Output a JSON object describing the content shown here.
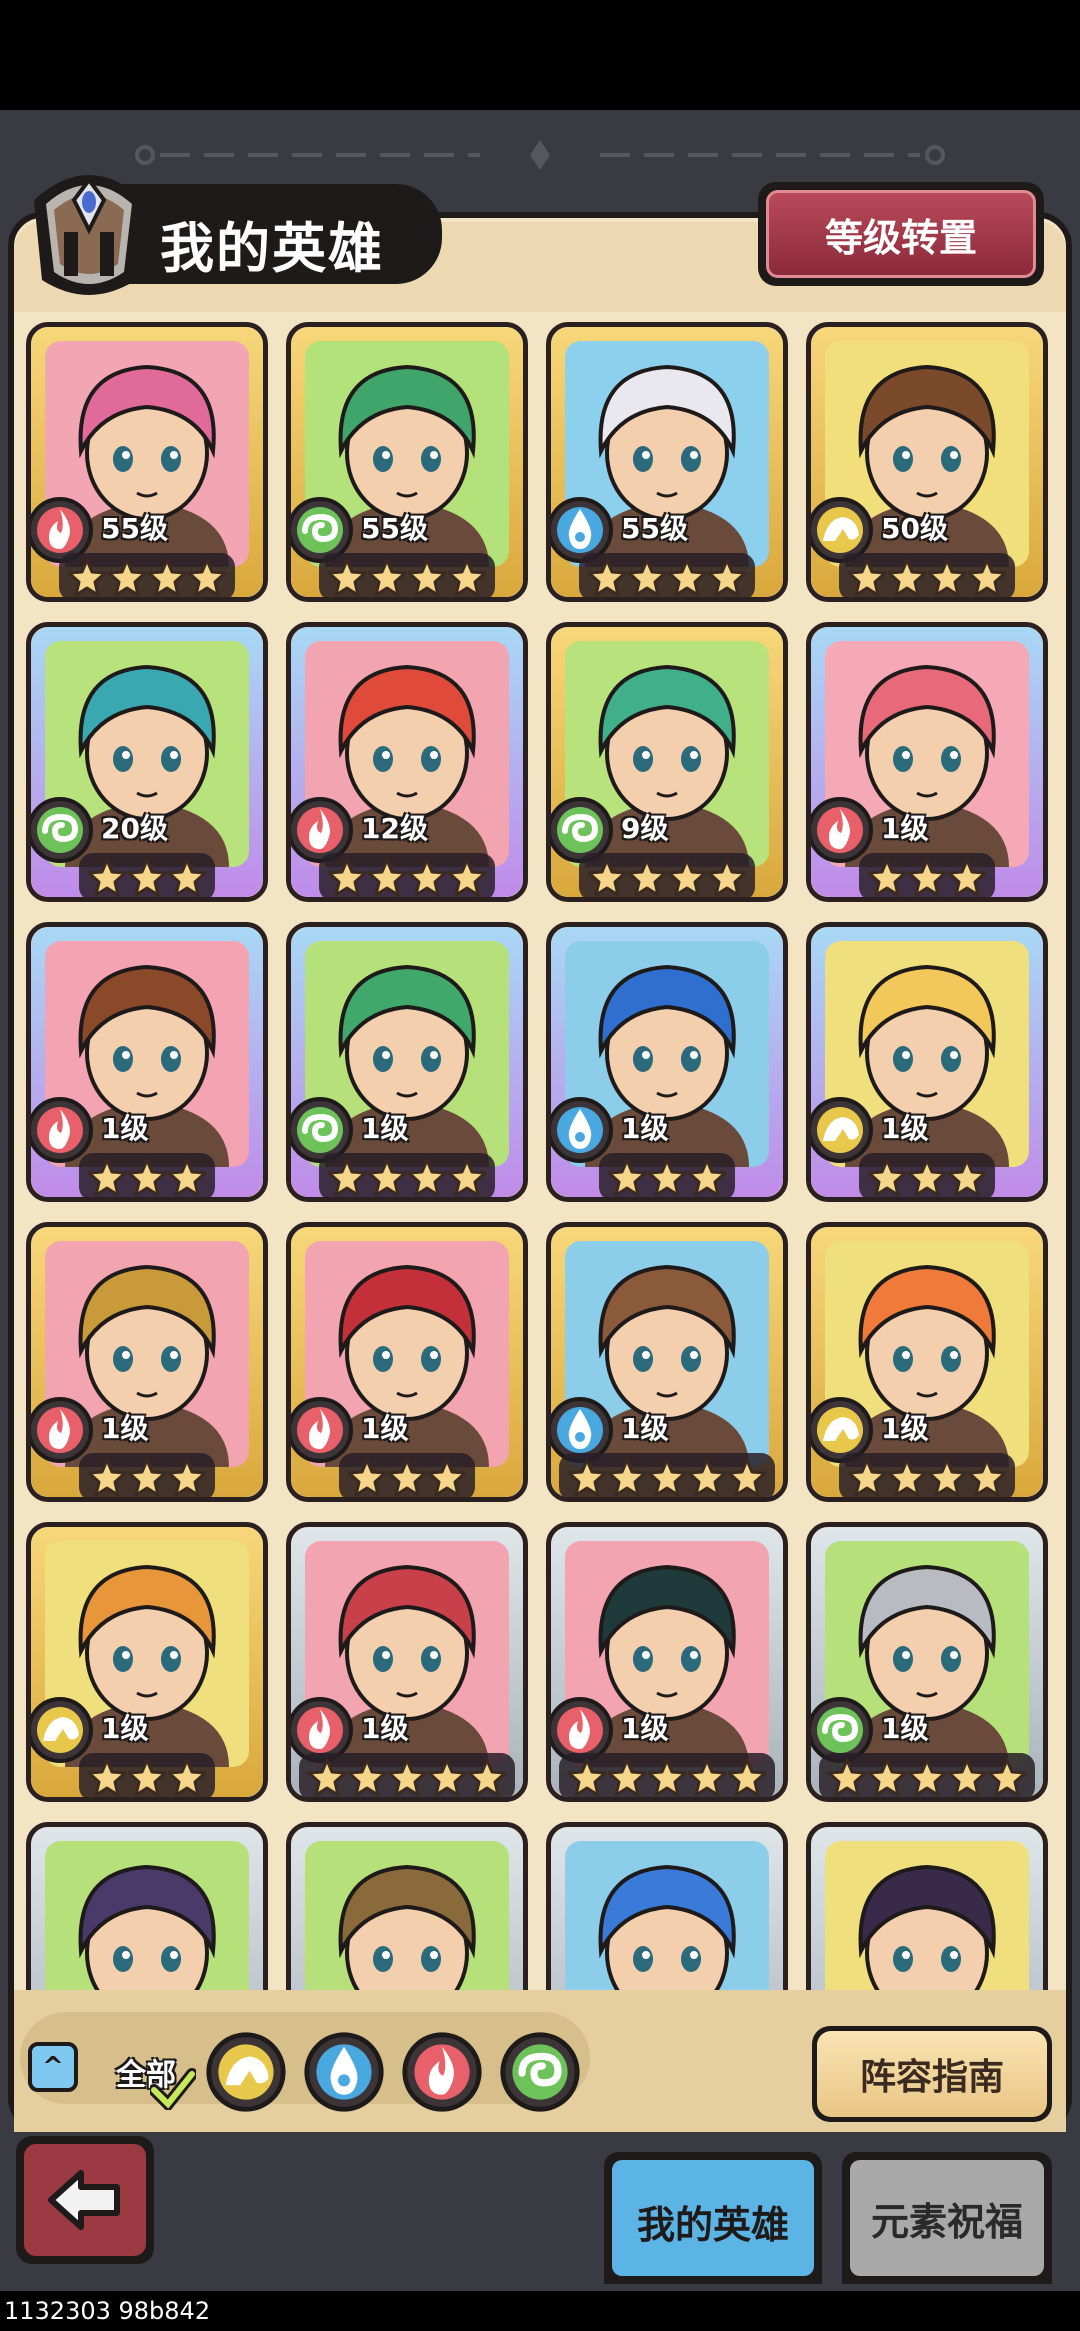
{
  "header": {
    "title": "我的英雄",
    "level_transfer_label": "等级转置"
  },
  "colors": {
    "fire": "#e8606a",
    "wood": "#6dc35a",
    "water": "#4aa8e0",
    "earth": "#e8c84a",
    "gold_frame": "#f1c65c",
    "purple_frame": "#b98be6",
    "silver_frame": "#c5ced4"
  },
  "heroes": [
    {
      "level": "55级",
      "element": "fire",
      "stars": 4,
      "rarity": "gold",
      "hair": "#e06a9a",
      "bg": "#f2a6b4"
    },
    {
      "level": "55级",
      "element": "wood",
      "stars": 4,
      "rarity": "gold",
      "hair": "#3fa56a",
      "bg": "#b3e27a"
    },
    {
      "level": "55级",
      "element": "water",
      "stars": 4,
      "rarity": "gold",
      "hair": "#e8e8ee",
      "bg": "#8cd0ee"
    },
    {
      "level": "50级",
      "element": "earth",
      "stars": 4,
      "rarity": "gold",
      "hair": "#7a4a2a",
      "bg": "#f0df7a"
    },
    {
      "level": "20级",
      "element": "wood",
      "stars": 3,
      "rarity": "purple",
      "hair": "#3aa8b0",
      "bg": "#b8e27c"
    },
    {
      "level": "12级",
      "element": "fire",
      "stars": 4,
      "rarity": "purple",
      "hair": "#e04a3a",
      "bg": "#f2a4b0"
    },
    {
      "level": "9级",
      "element": "wood",
      "stars": 4,
      "rarity": "gold",
      "hair": "#3fb08a",
      "bg": "#b8e27c"
    },
    {
      "level": "1级",
      "element": "fire",
      "stars": 3,
      "rarity": "purple",
      "hair": "#e86a7a",
      "bg": "#f5a9b7"
    },
    {
      "level": "1级",
      "element": "fire",
      "stars": 3,
      "rarity": "purple",
      "hair": "#8a4a2a",
      "bg": "#f3a3b1"
    },
    {
      "level": "1级",
      "element": "wood",
      "stars": 4,
      "rarity": "purple",
      "hair": "#3fa86a",
      "bg": "#b6e07a"
    },
    {
      "level": "1级",
      "element": "water",
      "stars": 3,
      "rarity": "purple",
      "hair": "#2f6fcf",
      "bg": "#8ccde9"
    },
    {
      "level": "1级",
      "element": "earth",
      "stars": 3,
      "rarity": "purple",
      "hair": "#f2c85a",
      "bg": "#f0e07d"
    },
    {
      "level": "1级",
      "element": "fire",
      "stars": 3,
      "rarity": "gold",
      "hair": "#c89a3a",
      "bg": "#f2a4b0"
    },
    {
      "level": "1级",
      "element": "fire",
      "stars": 3,
      "rarity": "gold",
      "hair": "#c4303a",
      "bg": "#f2a4b0"
    },
    {
      "level": "1级",
      "element": "water",
      "stars": 5,
      "rarity": "gold",
      "hair": "#8a5a3a",
      "bg": "#8ccde9"
    },
    {
      "level": "1级",
      "element": "earth",
      "stars": 4,
      "rarity": "gold",
      "hair": "#ef7a3a",
      "bg": "#f0e07d"
    },
    {
      "level": "1级",
      "element": "earth",
      "stars": 3,
      "rarity": "gold",
      "hair": "#e8963a",
      "bg": "#f0e07d"
    },
    {
      "level": "1级",
      "element": "fire",
      "stars": 5,
      "rarity": "silver",
      "hair": "#c8404a",
      "bg": "#f2a4b0"
    },
    {
      "level": "1级",
      "element": "fire",
      "stars": 5,
      "rarity": "silver",
      "hair": "#1e3a3a",
      "bg": "#f2a4b0"
    },
    {
      "level": "1级",
      "element": "wood",
      "stars": 5,
      "rarity": "silver",
      "hair": "#b8bcc2",
      "bg": "#b6e07a"
    },
    {
      "level": "",
      "element": "wood",
      "stars": 0,
      "rarity": "silver",
      "hair": "#4a3a6a",
      "bg": "#b6e07a"
    },
    {
      "level": "",
      "element": "wood",
      "stars": 0,
      "rarity": "silver",
      "hair": "#8a6a3a",
      "bg": "#b6e07a"
    },
    {
      "level": "",
      "element": "water",
      "stars": 0,
      "rarity": "silver",
      "hair": "#3a7ad8",
      "bg": "#8ccde9"
    },
    {
      "level": "",
      "element": "earth",
      "stars": 0,
      "rarity": "silver",
      "hair": "#3a2a4a",
      "bg": "#f0e07d"
    }
  ],
  "filters": {
    "all_label": "全部",
    "items": [
      "earth",
      "water",
      "fire",
      "wood"
    ]
  },
  "guide_label": "阵容指南",
  "tabs": {
    "my_heroes": "我的英雄",
    "element_blessing": "元素祝福"
  },
  "watermark": "1132303 98b842"
}
